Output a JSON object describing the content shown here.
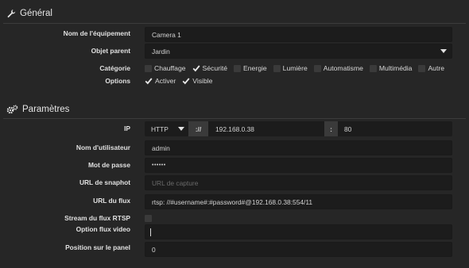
{
  "general": {
    "title": "Général",
    "name_label": "Nom de l'équipement",
    "name_value": "Camera 1",
    "parent_label": "Objet parent",
    "parent_value": "Jardin",
    "category_label": "Catégorie",
    "categories": [
      {
        "label": "Chauffage",
        "checked": false
      },
      {
        "label": "Sécurité",
        "checked": true
      },
      {
        "label": "Energie",
        "checked": false
      },
      {
        "label": "Lumière",
        "checked": false
      },
      {
        "label": "Automatisme",
        "checked": false
      },
      {
        "label": "Multimédia",
        "checked": false
      },
      {
        "label": "Autre",
        "checked": false
      }
    ],
    "options_label": "Options",
    "options": [
      {
        "label": "Activer",
        "checked": true
      },
      {
        "label": "Visible",
        "checked": true
      }
    ]
  },
  "params": {
    "title": "Paramètres",
    "ip_label": "IP",
    "protocol": "HTTP",
    "separator": "://",
    "ip_value": "192.168.0.38",
    "port_sep": ":",
    "port_value": "80",
    "user_label": "Nom d'utilisateur",
    "user_value": "admin",
    "pass_label": "Mot de passe",
    "pass_value": "••••••",
    "snaphot_label": "URL de snaphot",
    "snaphot_placeholder": "URL de capture",
    "flux_label": "URL du flux",
    "flux_value": "rtsp: //#username#:#password#@192.168.0.38:554/11",
    "rtsp_label": "Stream du flux RTSP",
    "rtsp_checked": false,
    "video_label": "Option flux video",
    "video_value": "",
    "position_label": "Position sur le panel",
    "position_value": "0"
  },
  "colors": {
    "background": "#262626",
    "field": "#1c1c1c",
    "text": "#d4d4d4"
  }
}
